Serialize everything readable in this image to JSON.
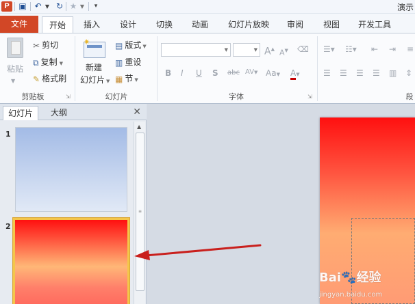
{
  "titlebar": {
    "app_icon_letter": "P",
    "window_title": "演示"
  },
  "tabs": [
    {
      "label": "文件"
    },
    {
      "label": "开始"
    },
    {
      "label": "插入"
    },
    {
      "label": "设计"
    },
    {
      "label": "切换"
    },
    {
      "label": "动画"
    },
    {
      "label": "幻灯片放映"
    },
    {
      "label": "审阅"
    },
    {
      "label": "视图"
    },
    {
      "label": "开发工具"
    }
  ],
  "ribbon": {
    "clipboard": {
      "paste_label": "粘贴",
      "cut_label": "剪切",
      "copy_label": "复制",
      "format_painter_label": "格式刷",
      "group_label": "剪贴板"
    },
    "slides": {
      "new_slide_label_1": "新建",
      "new_slide_label_2": "幻灯片",
      "layout_label": "版式",
      "reset_label": "重设",
      "section_label": "节",
      "group_label": "幻灯片"
    },
    "font": {
      "font_name_value": "",
      "font_size_value": "",
      "group_label": "字体",
      "grow_label": "A",
      "shrink_label": "A",
      "bold": "B",
      "italic": "I",
      "underline": "U",
      "shadow": "S",
      "strike": "abc",
      "spacing": "AV",
      "case": "Aa",
      "color": "A"
    },
    "paragraph": {
      "group_label": "段"
    }
  },
  "left_panel": {
    "tabs": [
      {
        "label": "幻灯片"
      },
      {
        "label": "大纲"
      }
    ],
    "close_glyph": "✕",
    "slides": [
      {
        "number": "1"
      },
      {
        "number": "2"
      }
    ]
  },
  "watermark": {
    "text": "Bai",
    "text2": "经验",
    "sub": "jingyan.baidu.com"
  },
  "colors": {
    "file_tab": "#d24726",
    "accent_blue": "#1f4e94",
    "selection": "#f4c64a",
    "arrow": "#c9201d"
  }
}
